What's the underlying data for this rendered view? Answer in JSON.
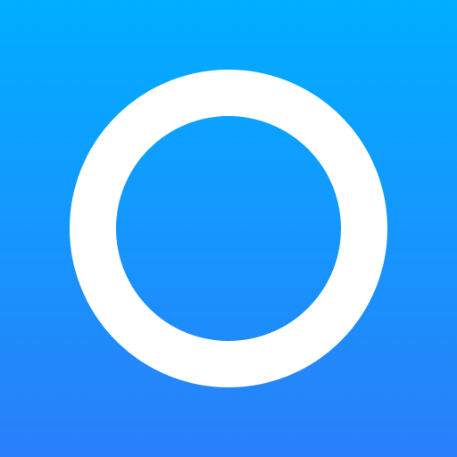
{
  "icon": {
    "name": "ring-icon",
    "shape": "ring",
    "colors": {
      "gradient_top": "#00AEFF",
      "gradient_bottom": "#2A7FFA",
      "ring": "#FFFFFF"
    }
  }
}
